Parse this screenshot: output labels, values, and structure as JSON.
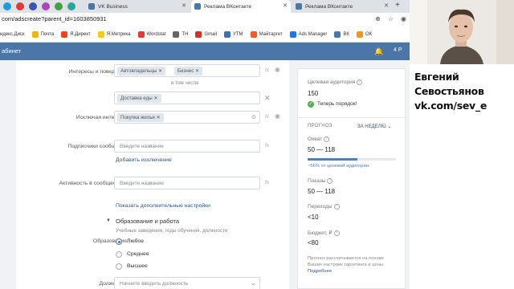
{
  "browser": {
    "tabs": [
      {
        "label": "VK Business",
        "active": false
      },
      {
        "label": "Реклама ВКонтакте",
        "active": true
      },
      {
        "label": "Реклама ВКонтакте",
        "active": false
      }
    ],
    "url": "com/adscreate?parent_id=1603850931",
    "bookmarks": [
      "ндекс.Диск",
      "Почта",
      "Я.Директ",
      "Я.Метрика",
      "Wordstat",
      "ТН",
      "Gmail",
      "УТМ",
      "Майтаргет",
      "Ads Manager",
      "ВК",
      "OK"
    ]
  },
  "vk": {
    "cabinet": "абинет",
    "balance": "4 Р"
  },
  "form": {
    "interests_label": "Интересы и поведение:",
    "interests_tags": [
      "Автовладельцы",
      "Бизнес"
    ],
    "including_hint": "в том числе",
    "interests_tags2": [
      "Доставка еды"
    ],
    "exclude_label": "Исключая интересы:",
    "exclude_tags": [
      "Покупка жилья"
    ],
    "subscribers_label": "Подписчики сообществ:",
    "subscribers_placeholder": "Введите название",
    "add_exclusion": "Добавить исключение",
    "activity_label": "Активность в сообществах:",
    "activity_placeholder": "Введите название",
    "show_more": "Показать дополнительные настройки",
    "fx": "fx",
    "education_title": "Образование и работа",
    "education_hint": "Учебные заведения, годы обучения, должности",
    "education_label": "Образование:",
    "education_options": [
      "Любое",
      "Среднее",
      "Высшее"
    ],
    "position_label": "Должности:",
    "position_placeholder": "Начните вводить должность"
  },
  "summary": {
    "audience_label": "Целевая аудитория",
    "audience_value": "150",
    "audience_ok": "Теперь порядок!",
    "forecast_label": "ПРОГНОЗ",
    "period": "ЗА НЕДЕЛЮ",
    "reach_label": "Охват",
    "reach_value": "50 — 118",
    "reach_note": "~56% от целевой аудитории",
    "reach_fraction": 0.56,
    "impressions_label": "Показы",
    "impressions_value": "50 — 118",
    "clicks_label": "Переходы",
    "clicks_value": "<10",
    "budget_label": "Бюджет, ₽",
    "budget_value": "<80",
    "note_text": "Прогноз рассчитывается на основе Ваших настроек таргетинга и цены.",
    "note_link": "Подробнее"
  },
  "overlay": {
    "line1": "Евгений",
    "line2": "Севостьянов",
    "line3": "vk.com/sev_e"
  },
  "colors": {
    "vk_blue": "#4a76a8",
    "ok_green": "#4bb34b",
    "progress": "#5181b8"
  }
}
